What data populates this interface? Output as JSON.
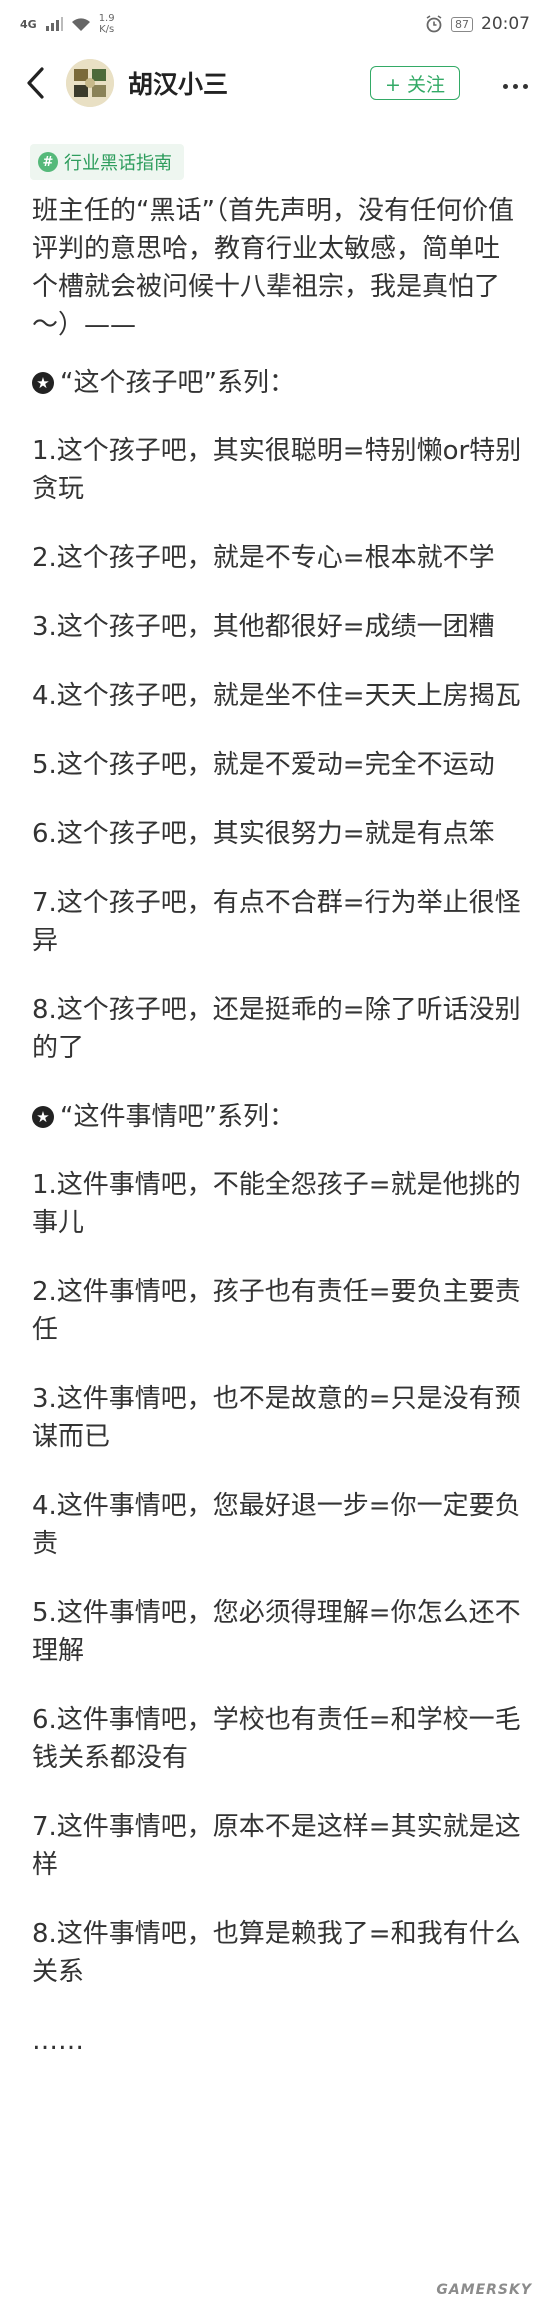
{
  "status_bar": {
    "signal": "4G",
    "speed_value": "1.9",
    "speed_unit": "K/s",
    "battery": "87",
    "time": "20:07"
  },
  "header": {
    "username": "胡汉小三",
    "follow_label": "+ 关注",
    "icons": {
      "back": "back-arrow-icon",
      "more": "more-dots-icon"
    }
  },
  "topic_tag": {
    "icon": "#",
    "label": "行业黑话指南"
  },
  "post": {
    "intro": "班主任的“黑话”（首先声明，没有任何价值评判的意思哈，教育行业太敏感，简单吐个槽就会被问候十八辈祖宗，我是真怕了～）——",
    "sections": [
      {
        "title": "“这个孩子吧”系列：",
        "items": [
          "1.这个孩子吧，其实很聪明=特别懒or特别贪玩",
          "2.这个孩子吧，就是不专心=根本就不学",
          "3.这个孩子吧，其他都很好=成绩一团糟",
          "4.这个孩子吧，就是坐不住=天天上房揭瓦",
          "5.这个孩子吧，就是不爱动=完全不运动",
          "6.这个孩子吧，其实很努力=就是有点笨",
          "7.这个孩子吧，有点不合群=行为举止很怪异",
          "8.这个孩子吧，还是挺乖的=除了听话没别的了"
        ]
      },
      {
        "title": "“这件事情吧”系列：",
        "items": [
          "1.这件事情吧，不能全怨孩子=就是他挑的事儿",
          "2.这件事情吧，孩子也有责任=要负主要责任",
          "3.这件事情吧，也不是故意的=只是没有预谋而已",
          "4.这件事情吧，您最好退一步=你一定要负责",
          "5.这件事情吧，您必须得理解=你怎么还不理解",
          "6.这件事情吧，学校也有责任=和学校一毛钱关系都没有",
          "7.这件事情吧，原本不是这样=其实就是这样",
          "8.这件事情吧，也算是赖我了=和我有什么关系"
        ]
      }
    ],
    "ellipsis": "……"
  },
  "watermark": "GAMERSKY"
}
